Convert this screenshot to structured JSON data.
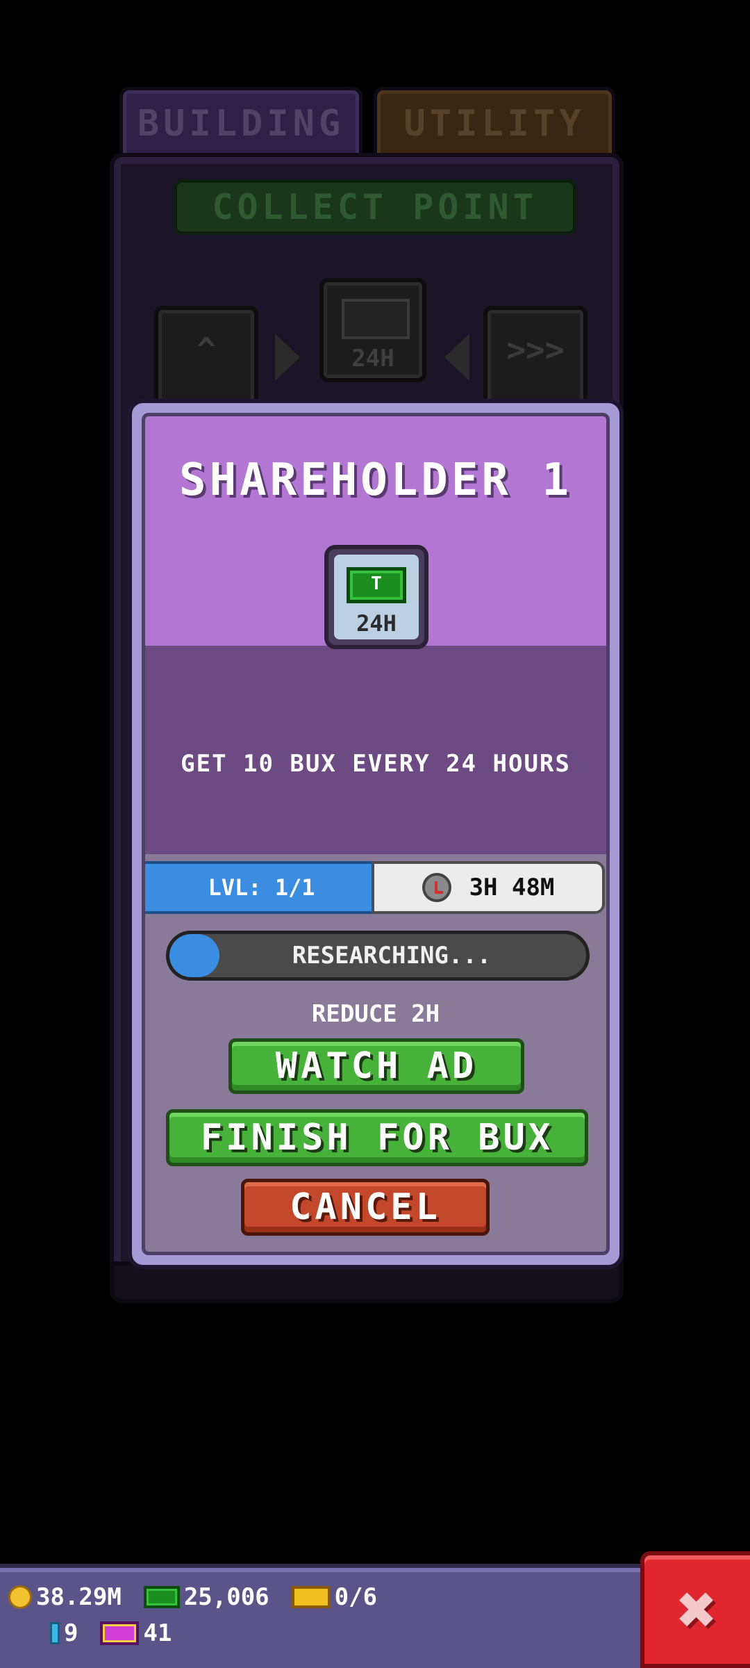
{
  "tabs": {
    "building": "BUILDING",
    "utility": "UTILITY"
  },
  "background_panel": {
    "banner": "COLLECT POINT",
    "center_slot_label": "24H",
    "left_slot_glyph": "^",
    "right_slot_glyph": ">>>"
  },
  "dialog": {
    "title": "SHAREHOLDER 1",
    "icon": {
      "name": "bux-bill-icon",
      "mark": "T",
      "label": "24H"
    },
    "description": "GET 10 BUX EVERY 24 HOURS",
    "level": "LVL: 1/1",
    "timer": "3H 48M",
    "progress": {
      "label": "RESEARCHING...",
      "fraction": 0.12
    },
    "reduce_label": "REDUCE 2H",
    "buttons": {
      "watch_ad": "WATCH AD",
      "finish_for_bux": "FINISH FOR BUX",
      "cancel": "CANCEL"
    }
  },
  "hud": {
    "coins": "38.29M",
    "bux": "25,006",
    "tickets": "0/6",
    "gems": "9",
    "vip": "41",
    "close_glyph": "✖"
  },
  "colors": {
    "dialog_top": "#b276d3",
    "dialog_mid": "#6d4a82",
    "dialog_bottom": "#8a7a9a",
    "accent_blue": "#3a8de0",
    "button_green": "#46b23a",
    "button_red": "#c3472a",
    "hud_bg": "#5b5488",
    "close_red": "#e0262f"
  }
}
